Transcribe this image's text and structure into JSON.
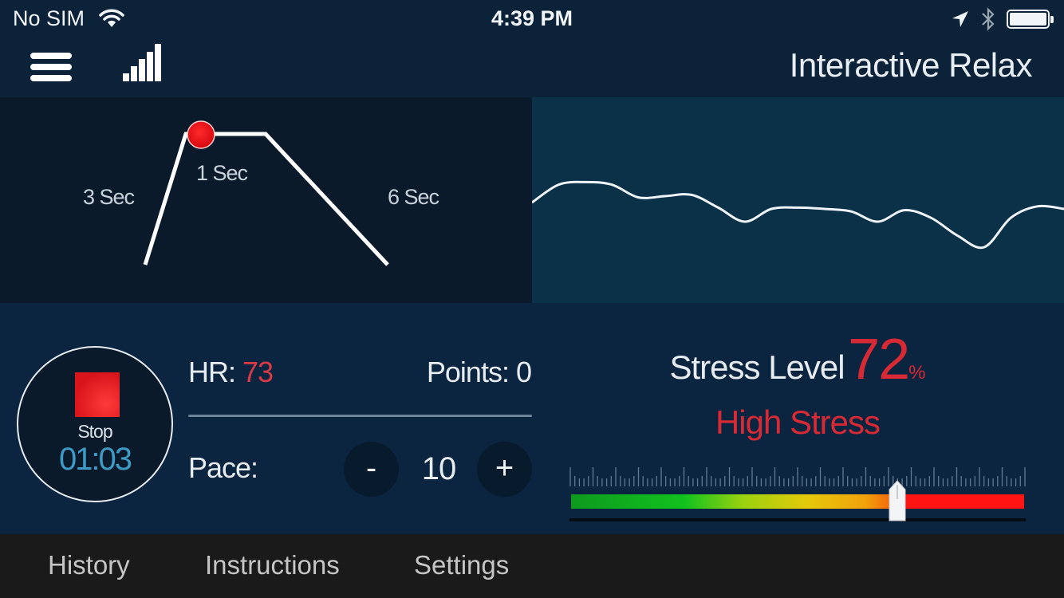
{
  "status_bar": {
    "carrier": "No SIM",
    "time": "4:39 PM",
    "icons": [
      "wifi-icon",
      "location-arrow-icon",
      "bluetooth-icon",
      "battery-icon"
    ]
  },
  "header": {
    "menu_icon": "hamburger-menu-icon",
    "signal_icon": "signal-bars-icon",
    "title": "Interactive Relax"
  },
  "breath_pattern": {
    "inhale_label": "3 Sec",
    "hold_label": "1 Sec",
    "exhale_label": "6 Sec",
    "phases_seconds": {
      "inhale": 3,
      "hold": 1,
      "exhale": 6
    },
    "indicator_color": "#e8121b",
    "indicator_phase": "hold-start"
  },
  "hrv_wave": {
    "description": "live heart-rate variability waveform",
    "samples": [
      0.55,
      0.69,
      0.71,
      0.69,
      0.59,
      0.6,
      0.61,
      0.51,
      0.4,
      0.5,
      0.51,
      0.5,
      0.48,
      0.4,
      0.49,
      0.43,
      0.29,
      0.2,
      0.43,
      0.52,
      0.5
    ]
  },
  "session": {
    "stop_label": "Stop",
    "elapsed": "01:03",
    "hr_label": "HR:",
    "hr_value": "73",
    "points_label": "Points:",
    "points_value": "0",
    "pace_label": "Pace:",
    "pace_minus": "-",
    "pace_value": "10",
    "pace_plus": "+"
  },
  "stress": {
    "label": "Stress Level",
    "value": "72",
    "unit": "%",
    "status": "High Stress",
    "gauge_fraction": 0.72,
    "accent_color": "#d82a34"
  },
  "tabs": [
    {
      "label": "History"
    },
    {
      "label": "Instructions"
    },
    {
      "label": "Settings"
    }
  ]
}
